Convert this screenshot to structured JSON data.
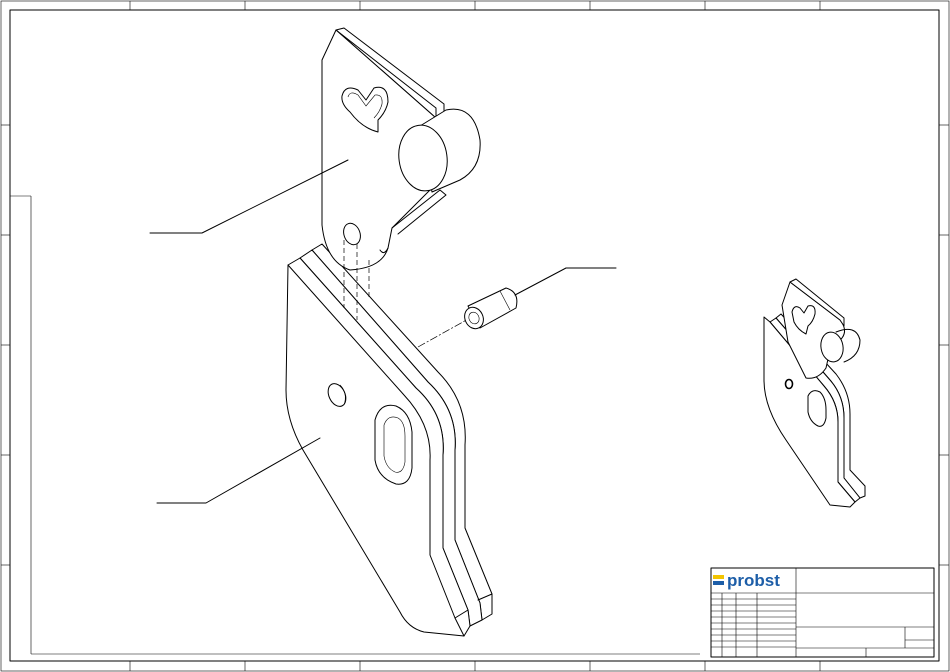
{
  "title_block": {
    "brand_name": "probst",
    "brand_color": "#1d5ea8",
    "brand_accent_color": "#f2c400"
  },
  "callouts": [
    {
      "id": "upper-bracket-callout"
    },
    {
      "id": "lower-plate-callout"
    },
    {
      "id": "pin-callout"
    }
  ]
}
